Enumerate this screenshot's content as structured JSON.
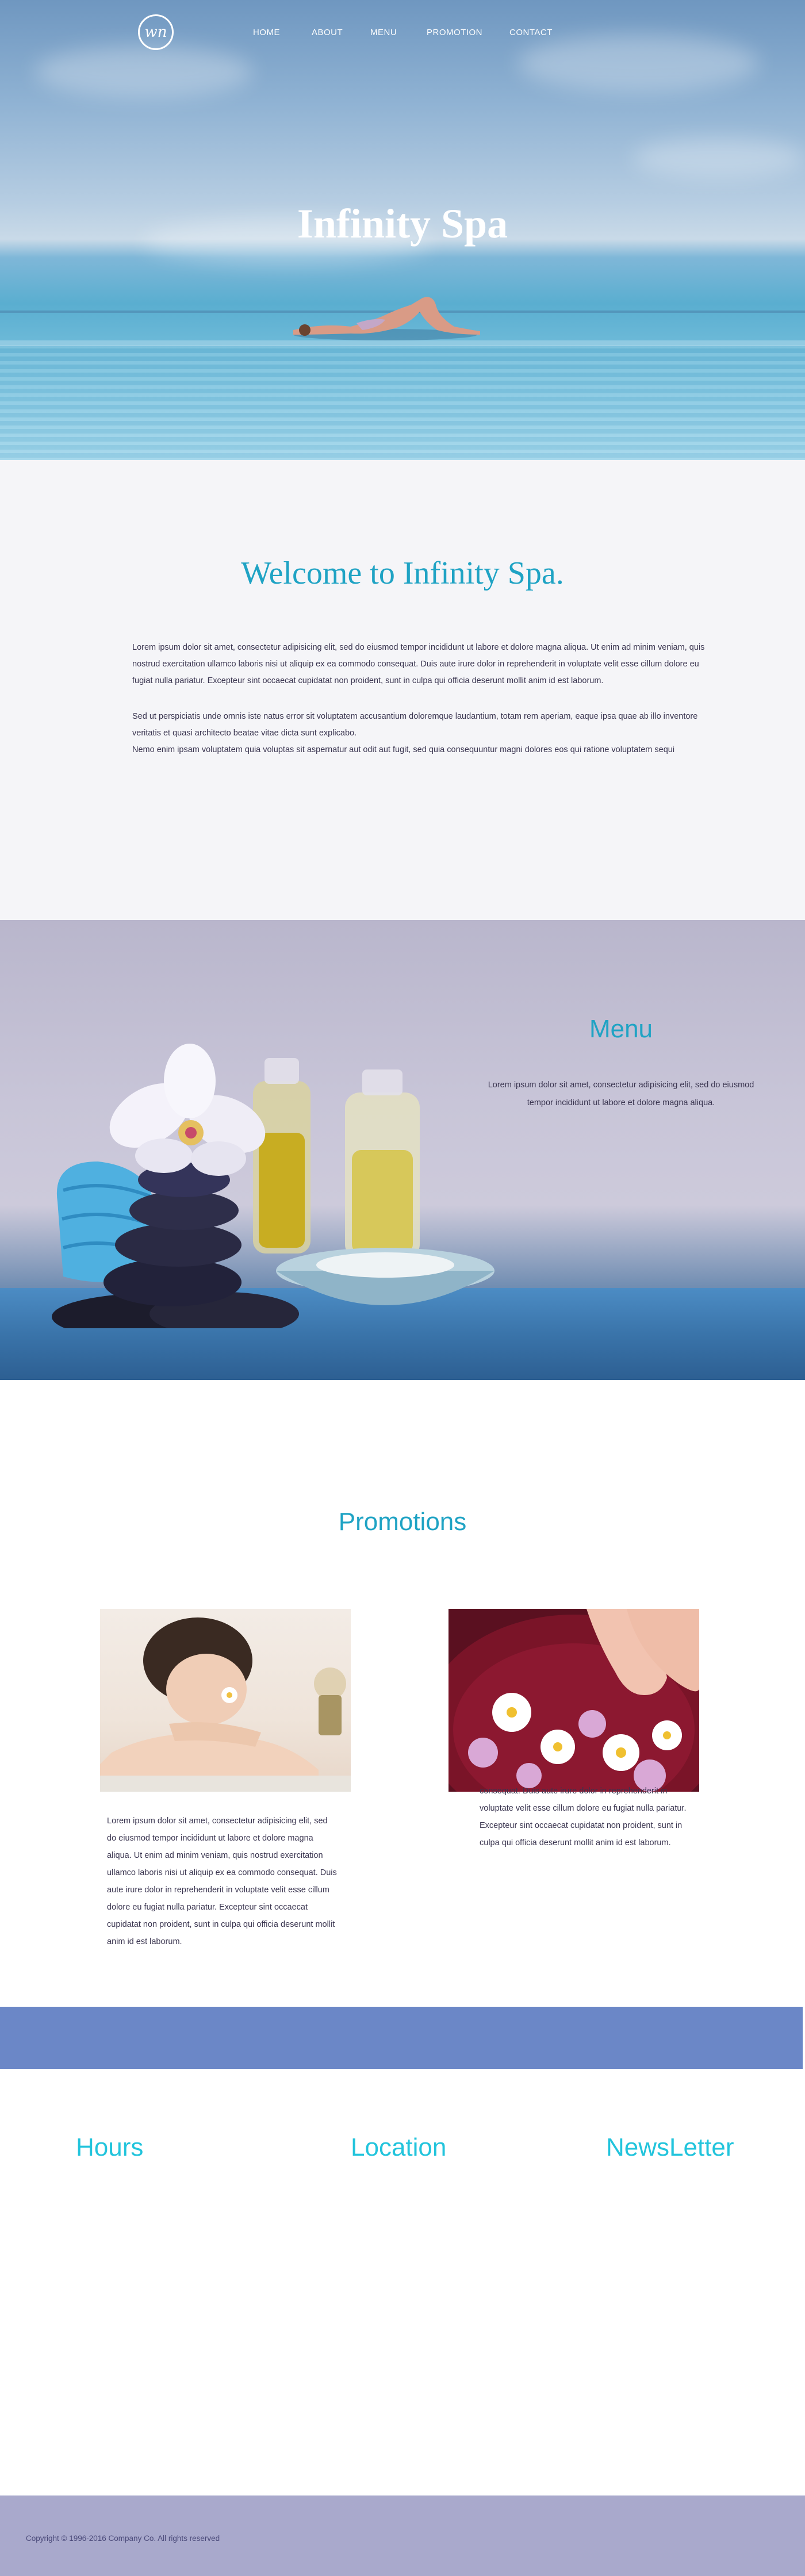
{
  "brand": {
    "logo_text": "wn"
  },
  "nav": {
    "items": [
      "HOME",
      "ABOUT",
      "MENU",
      "PROMOTION",
      "CONTACT"
    ]
  },
  "hero": {
    "title": "Infinity Spa"
  },
  "welcome": {
    "heading": "Welcome to Infinity Spa.",
    "paragraph1": "Lorem ipsum dolor sit amet, consectetur adipisicing elit, sed do eiusmod tempor incididunt ut labore et dolore magna aliqua. Ut enim ad minim veniam, quis nostrud exercitation ullamco laboris nisi ut aliquip ex ea commodo consequat. Duis aute irure dolor in reprehenderit in voluptate velit esse cillum dolore eu fugiat nulla pariatur. Excepteur sint occaecat cupidatat non proident, sunt in culpa qui officia deserunt mollit anim id est laborum.",
    "paragraph2": "Sed ut perspiciatis unde omnis iste natus error sit voluptatem accusantium doloremque laudantium, totam rem aperiam, eaque ipsa quae ab illo inventore veritatis et quasi architecto beatae vitae dicta sunt explicabo.",
    "paragraph3": "Nemo enim ipsam voluptatem quia voluptas sit aspernatur aut odit aut fugit, sed quia consequuntur magni dolores eos qui ratione voluptatem sequi"
  },
  "menu": {
    "heading": "Menu",
    "text": "Lorem ipsum dolor sit amet, consectetur adipisicing elit, sed do eiusmod tempor incididunt ut labore et dolore magna aliqua."
  },
  "promotions": {
    "heading": "Promotions",
    "left_text": "Lorem ipsum dolor sit amet, consectetur adipisicing elit, sed do eiusmod tempor incididunt ut labore et dolore magna aliqua. Ut enim ad minim veniam, quis nostrud exercitation ullamco laboris nisi ut aliquip ex ea commodo consequat. Duis aute irure dolor in reprehenderit in voluptate velit esse cillum dolore eu fugiat nulla pariatur. Excepteur sint occaecat cupidatat non proident, sunt in culpa qui officia deserunt mollit anim id est laborum.",
    "right_text": "consequat. Duis aute irure dolor in reprehenderit in voluptate velit esse cillum dolore eu fugiat nulla pariatur. Excepteur sint occaecat cupidatat non proident, sunt in culpa qui officia deserunt mollit anim id est laborum."
  },
  "info": {
    "hours": "Hours",
    "location": "Location",
    "newsletter": "NewsLetter"
  },
  "footer": {
    "copyright": "Copyright © 1996-2016 Company Co. All rights reserved"
  },
  "colors": {
    "accent": "#1fa3c4",
    "band": "#6b87c7",
    "footer": "#a9a9cc",
    "text": "#3a3550"
  }
}
